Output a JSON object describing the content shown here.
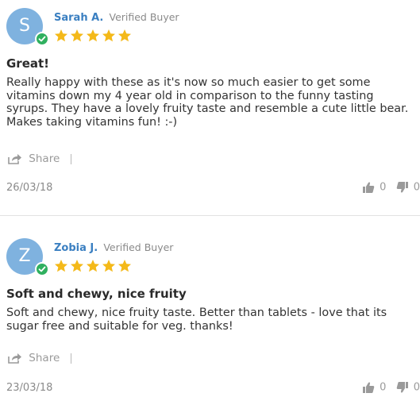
{
  "reviews": [
    {
      "avatar_initial": "S",
      "name": "Sarah A.",
      "verified_label": "Verified Buyer",
      "rating": 5,
      "max_rating": 5,
      "title": "Great!",
      "body": "Really happy with these as it's now so much easier to get some vitamins down my 4 year old in comparison to the funny tasting syrups. They have a lovely fruity taste and resemble a cute little bear. Makes taking vitamins fun! :-)",
      "share_label": "Share",
      "date": "26/03/18",
      "thumbs_up_count": "0",
      "thumbs_down_count": "0"
    },
    {
      "avatar_initial": "Z",
      "name": "Zobia J.",
      "verified_label": "Verified Buyer",
      "rating": 5,
      "max_rating": 5,
      "title": "Soft and chewy, nice fruity",
      "body": "Soft and chewy, nice fruity taste. Better than tablets - love that its sugar free and suitable for veg. thanks!",
      "share_label": "Share",
      "date": "23/03/18",
      "thumbs_up_count": "0",
      "thumbs_down_count": "0"
    }
  ],
  "colors": {
    "avatar_bg": "#7fb2df",
    "verified_badge": "#2fb05f",
    "star": "#f4b919",
    "name": "#3a7fc1",
    "muted_text": "#8a8a8a"
  },
  "icons": {
    "star": "star-icon",
    "verified": "check-badge-icon",
    "share": "share-icon",
    "thumbs_up": "thumbs-up-icon",
    "thumbs_down": "thumbs-down-icon"
  }
}
